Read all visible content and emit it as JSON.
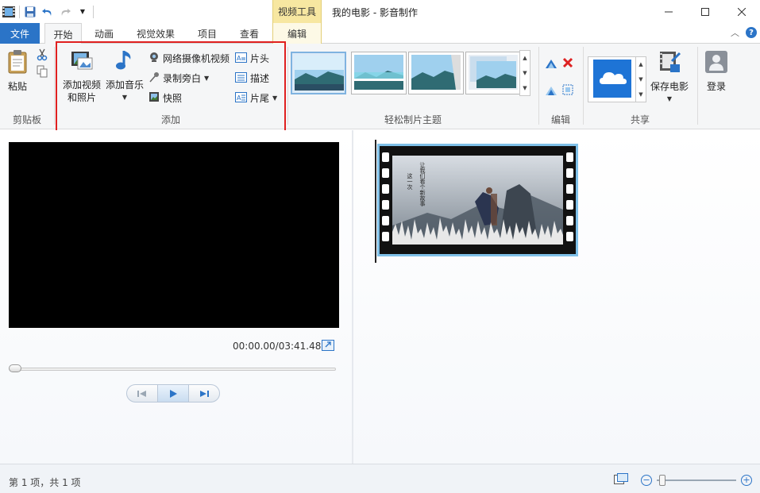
{
  "title_bar": {
    "context_tab_group": "视频工具",
    "window_title": "我的电影 - 影音制作"
  },
  "tabs": {
    "file": "文件",
    "home": "开始",
    "animations": "动画",
    "visual_effects": "视觉效果",
    "project": "项目",
    "view": "查看",
    "edit": "编辑"
  },
  "ribbon": {
    "clipboard": {
      "label": "剪贴板",
      "paste": "粘贴"
    },
    "add": {
      "label": "添加",
      "add_video_line1": "添加视频",
      "add_video_line2": "和照片",
      "add_music": "添加音乐",
      "webcam_video": "网络摄像机视频",
      "record_narration": "录制旁白",
      "snapshot": "快照",
      "title": "片头",
      "caption": "描述",
      "credits": "片尾"
    },
    "themes": {
      "label": "轻松制片主题"
    },
    "editing": {
      "label": "编辑"
    },
    "share": {
      "label": "共享",
      "save_movie": "保存电影"
    },
    "account": {
      "sign_in": "登录"
    }
  },
  "player": {
    "time": "00:00.00/03:41.48"
  },
  "storyboard": {
    "clip_caption_1": "这一次",
    "clip_caption_2": "让我们看个新故事"
  },
  "status": {
    "item_count": "第 1 项，共 1 项"
  },
  "colors": {
    "accent": "#2b74c7",
    "context_tab": "#f7e7a1",
    "highlight_box": "#e02020",
    "clip_selection": "#7fc0e8"
  }
}
